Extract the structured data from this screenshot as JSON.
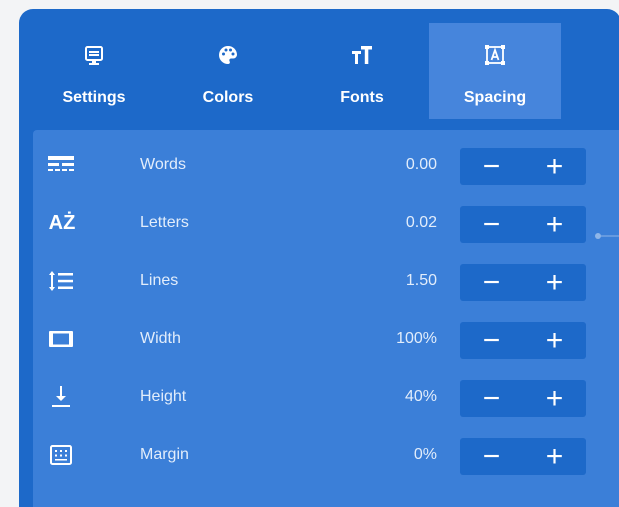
{
  "tabs": [
    {
      "label": "Settings",
      "icon": "settings-icon",
      "active": false
    },
    {
      "label": "Colors",
      "icon": "palette-icon",
      "active": false
    },
    {
      "label": "Fonts",
      "icon": "font-size-icon",
      "active": false
    },
    {
      "label": "Spacing",
      "icon": "spacing-icon",
      "active": true
    }
  ],
  "rows": [
    {
      "label": "Words",
      "value": "0.00",
      "icon": "word-spacing-icon"
    },
    {
      "label": "Letters",
      "value": "0.02",
      "icon": "letter-spacing-icon"
    },
    {
      "label": "Lines",
      "value": "1.50",
      "icon": "line-spacing-icon"
    },
    {
      "label": "Width",
      "value": "100%",
      "icon": "width-icon"
    },
    {
      "label": "Height",
      "value": "40%",
      "icon": "height-icon"
    },
    {
      "label": "Margin",
      "value": "0%",
      "icon": "margin-icon"
    }
  ],
  "stepper": {
    "minus": "−",
    "plus": "+"
  },
  "icon_glyphs": {
    "letters": "AŻ"
  },
  "colors": {
    "panel": "#1d69c9",
    "active_tab": "#4685dc",
    "content": "#3b7fd8",
    "text": "#ffffff",
    "muted_text": "#e2edfb"
  }
}
